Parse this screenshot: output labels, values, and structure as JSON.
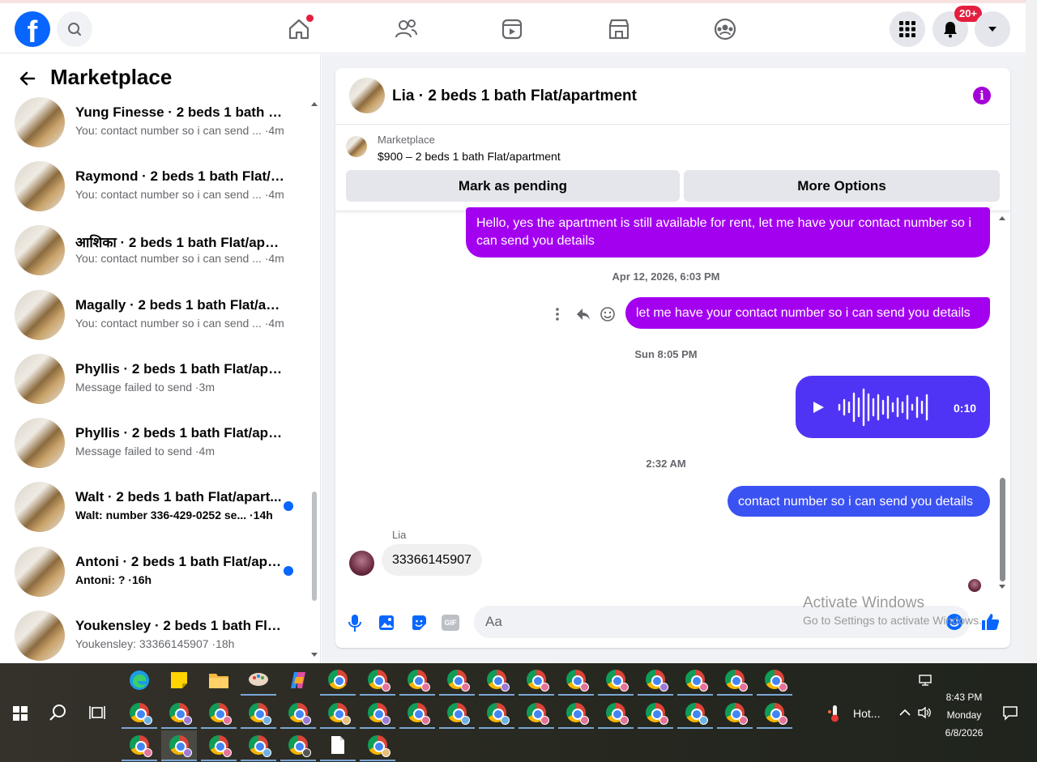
{
  "topbar": {
    "logo": "f",
    "notifications_badge": "20+"
  },
  "sidebar": {
    "title": "Marketplace",
    "conversations": [
      {
        "name": "Yung Finesse · 2 beds 1 bath Flat...",
        "preview": "You: contact number so i can send ... ·4m",
        "unread": false
      },
      {
        "name": "Raymond · 2 beds 1 bath Flat/ap...",
        "preview": "You: contact number so i can send ... ·4m",
        "unread": false
      },
      {
        "name": "आशिका · 2 beds 1 bath Flat/apart...",
        "preview": "You: contact number so i can send ... ·4m",
        "unread": false
      },
      {
        "name": "Magally · 2 beds 1 bath Flat/apar...",
        "preview": "You: contact number so i can send ... ·4m",
        "unread": false
      },
      {
        "name": "Phyllis · 2 beds 1 bath Flat/apart...",
        "preview": "Message failed to send ·3m",
        "unread": false
      },
      {
        "name": "Phyllis · 2 beds 1 bath Flat/apart...",
        "preview": "Message failed to send ·4m",
        "unread": false
      },
      {
        "name": "Walt · 2 beds 1 bath Flat/apart...",
        "preview": "Walt: number 336-429-0252 se... ·14h",
        "unread": true
      },
      {
        "name": "Antoni · 2 beds 1 bath Flat/apa...",
        "preview": "Antoni: ? ·16h",
        "unread": true
      },
      {
        "name": "Youkensley · 2 beds 1 bath Flat/a...",
        "preview": "Youkensley: 33366145907 ·18h",
        "unread": false
      }
    ]
  },
  "chat": {
    "title": "Lia · 2 beds 1 bath Flat/apartment",
    "listing_label": "Marketplace",
    "listing_price": "$900 – 2 beds 1 bath Flat/apartment",
    "mark_pending": "Mark as pending",
    "more_options": "More Options",
    "msg1": "Hello, yes the apartment is still available for rent, let me have your contact number so i can send you details",
    "stamp1": "Apr 12, 2026, 6:03 PM",
    "msg2": "let me have your contact number so i can send you details",
    "stamp2": "Sun 8:05 PM",
    "voice_duration": "0:10",
    "stamp3": "2:32 AM",
    "msg3": "contact number so i can send you details",
    "sender": "Lia",
    "msg4": "33366145907",
    "input_placeholder": "Aa",
    "gif_label": "GIF"
  },
  "watermark": {
    "line1": "Activate Windows",
    "line2": "Go to Settings to activate Windows."
  },
  "taskbar": {
    "weather": "Hot...",
    "time": "8:43 PM",
    "day": "Monday",
    "date": "6/8/2026"
  },
  "colors": {
    "brand": "#0866ff",
    "purple_bubble": "#a400f0",
    "blue_bubble": "#3b52f2"
  }
}
